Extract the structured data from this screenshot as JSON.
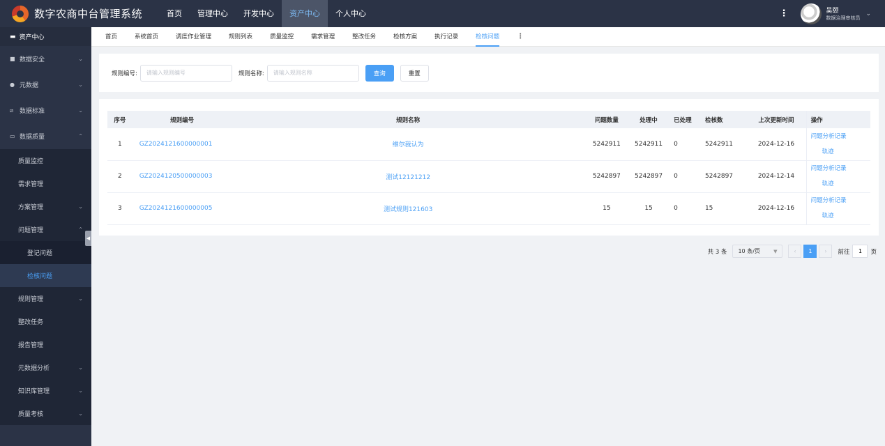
{
  "app": {
    "title": "数字农商中台管理系统"
  },
  "topnav": [
    "首页",
    "管理中心",
    "开发中心",
    "资产中心",
    "个人中心"
  ],
  "user": {
    "name": "吴颐",
    "role": "数据治理审核员"
  },
  "sidebar": {
    "header": "资产中心",
    "items": [
      {
        "label": "数据安全"
      },
      {
        "label": "元数据"
      },
      {
        "label": "数据标准"
      },
      {
        "label": "数据质量"
      }
    ],
    "quality_sub": [
      "质量监控",
      "需求管理",
      "方案管理",
      "问题管理"
    ],
    "problem_sub": [
      "登记问题",
      "检核问题"
    ],
    "quality_sub2": [
      "规则管理",
      "整改任务",
      "报告管理",
      "元数据分析",
      "知识库管理",
      "质量考核"
    ]
  },
  "tabs": [
    "首页",
    "系统首页",
    "调度作业管理",
    "规则列表",
    "质量监控",
    "需求管理",
    "整改任务",
    "检核方案",
    "执行记录",
    "检核问题"
  ],
  "filter": {
    "code_label": "规则编号:",
    "code_placeholder": "请输入规则编号",
    "name_label": "规则名称:",
    "name_placeholder": "请输入规则名称",
    "query": "查询",
    "reset": "重置"
  },
  "table": {
    "headers": [
      "序号",
      "规则编号",
      "规则名称",
      "问题数量",
      "处理中",
      "已处理",
      "检核数",
      "上次更新时间",
      "操作"
    ],
    "rows": [
      {
        "idx": "1",
        "code": "GZ2024121600000001",
        "name": "维尔我认为",
        "count": "5242911",
        "processing": "5242911",
        "done": "0",
        "checks": "5242911",
        "date": "2024-12-16"
      },
      {
        "idx": "2",
        "code": "GZ2024120500000003",
        "name": "测试12121212",
        "count": "5242897",
        "processing": "5242897",
        "done": "0",
        "checks": "5242897",
        "date": "2024-12-14"
      },
      {
        "idx": "3",
        "code": "GZ2024121600000005",
        "name": "测试规则121603",
        "count": "15",
        "processing": "15",
        "done": "0",
        "checks": "15",
        "date": "2024-12-16"
      }
    ],
    "op_record": "问题分析记录",
    "op_trace": "轨迹"
  },
  "pager": {
    "total": "共 3 条",
    "size": "10 条/页",
    "current": "1",
    "goto": "前往",
    "page_value": "1",
    "page_unit": "页"
  },
  "colors": {
    "accent": "#4a9ff5",
    "nav_bg": "#2b3346"
  }
}
